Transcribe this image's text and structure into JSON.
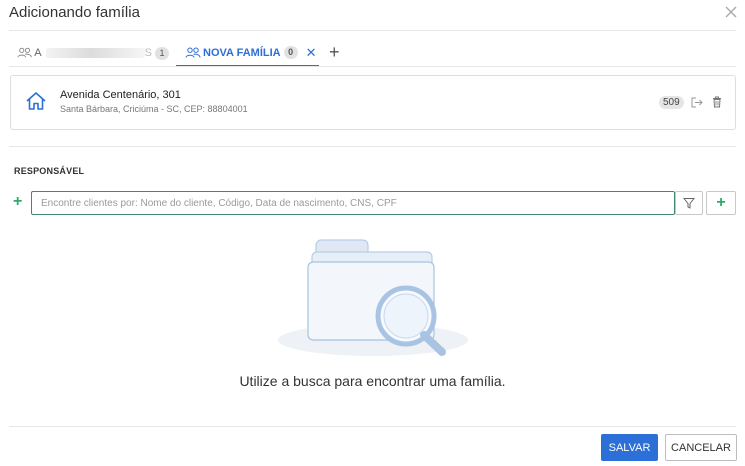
{
  "dialog": {
    "title": "Adicionando família"
  },
  "tabs": [
    {
      "label_prefix": "A",
      "label_suffix": "S",
      "badge": "1"
    },
    {
      "label": "NOVA FAMÍLIA",
      "badge": "0",
      "close": "✕"
    }
  ],
  "add_tab_label": "+",
  "address": {
    "street": "Avenida Centenário, 301",
    "city": "Santa Bárbara, Criciúma - SC, CEP: 88804001",
    "number_badge": "509"
  },
  "responsavel": {
    "section_label": "RESPONSÁVEL",
    "add_label": "+",
    "search_placeholder": "Encontre clientes por: Nome do cliente, Código, Data de nascimento, CNS, CPF",
    "add_button_label": "+"
  },
  "empty_state": {
    "message": "Utilize a busca para encontrar uma família."
  },
  "footer": {
    "save_label": "SALVAR",
    "cancel_label": "CANCELAR"
  },
  "colors": {
    "accent": "#2c6fd6",
    "add_green": "#2eab6b",
    "search_border": "#3f8a6e"
  }
}
